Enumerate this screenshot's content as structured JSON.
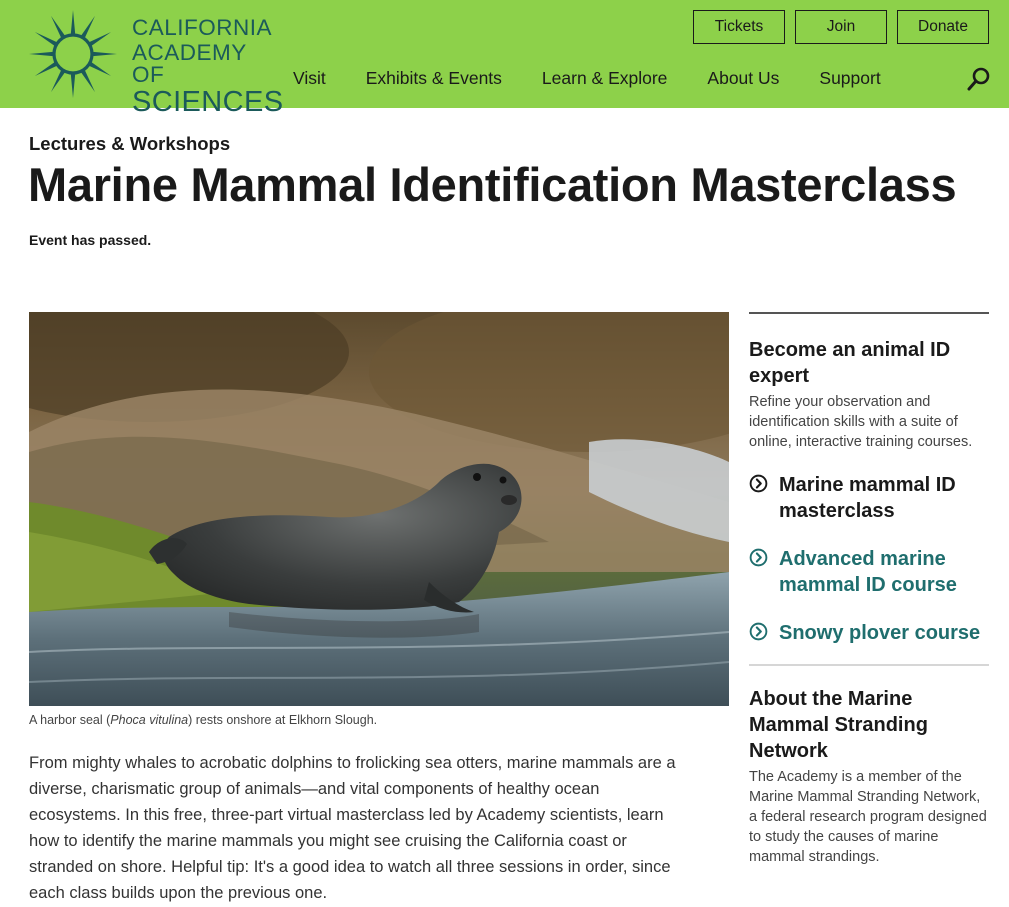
{
  "header": {
    "logo_line1": "CALIFORNIA",
    "logo_line2": "ACADEMY OF",
    "logo_line3": "SCIENCES",
    "buttons": [
      "Tickets",
      "Join",
      "Donate"
    ],
    "nav": [
      "Visit",
      "Exhibits & Events",
      "Learn & Explore",
      "About Us",
      "Support"
    ],
    "search_icon": "search-icon",
    "brand_color": "#8dd14a",
    "logo_color": "#1b5a5a"
  },
  "page": {
    "eyebrow": "Lectures & Workshops",
    "title": "Marine Mammal Identification Masterclass",
    "status": "Event has passed.",
    "caption_pre": "A harbor seal (",
    "caption_italic": "Phoca vitulina",
    "caption_post": ") rests onshore at Elkhorn Slough.",
    "body": "From mighty whales to acrobatic dolphins to frolicking sea otters, marine mammals are a diverse, charismatic group of animals—and vital components of healthy ocean ecosystems. In this free, three-part virtual masterclass led by Academy scientists, learn how to identify the marine mammals you might see cruising the California coast or stranded on shore. Helpful tip: It's a good idea to watch all three sessions in order, since each class builds upon the previous one."
  },
  "sidebar": {
    "heading1": "Become an animal ID expert",
    "text1": "Refine your observation and identification skills with a suite of online, interactive training courses.",
    "links": [
      {
        "label": "Marine mammal ID masterclass",
        "color": "#1a1a1a"
      },
      {
        "label": "Advanced marine mammal ID course",
        "color": "#1f6e6e"
      },
      {
        "label": "Snowy plover course",
        "color": "#1f6e6e"
      }
    ],
    "heading2": "About the Marine Mammal Stranding Network",
    "text2": "The Academy is a member of the Marine Mammal Stranding Network, a federal research program designed to study the causes of marine mammal strandings."
  }
}
